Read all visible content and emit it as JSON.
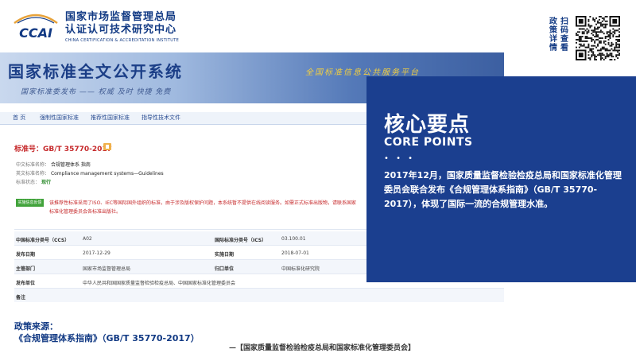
{
  "header": {
    "logo_text": "CCAI",
    "org_name_line1": "国家市场监督管理总局",
    "org_name_line2": "认证认可技术研究中心",
    "org_name_en": "CHINA CERTIFICATION & ACCREDITATION INSTITUTE",
    "scan_text_col1": "政策详情",
    "scan_text_col2": "扫码查看",
    "qr_icon": "qr-code-icon"
  },
  "site": {
    "title": "国家标准全文公开系统",
    "tagline": "国家标准委发布 —— 权威 及时 快捷 免费",
    "slogan": "全国标准信息公共服务平台",
    "nav": [
      "首 页",
      "强制性国家标准",
      "推荐性国家标准",
      "指导性技术文件"
    ],
    "std_number": "标准号：GB/T 35770-2017",
    "cn_name_label": "中文标准名称：",
    "cn_name_value": "合规管理体系 指南",
    "en_name_label": "英文标准名称：",
    "en_name_value": "Compliance management systems—Guidelines",
    "status_label": "标准状态：",
    "status_value": "现行",
    "button_label": "实施信息反馈",
    "notice": "该推荐性标准采用了ISO、IEC等国际国外组织的标准，由于涉及版权保护问题，本系统暂不提供在线阅读服务。如需正式标准出版物，请联系国家标准化管理委员会各标准出版社。",
    "table": [
      {
        "k1": "中国标准分类号（CCS）",
        "v1": "A02",
        "k2": "国际标准分类号（ICS）",
        "v2": "03.100.01"
      },
      {
        "k1": "发布日期",
        "v1": "2017-12-29",
        "k2": "实施日期",
        "v2": "2018-07-01"
      },
      {
        "k1": "主管部门",
        "v1": "国家市场监督管理总局",
        "k2": "归口单位",
        "v2": "中国标准化研究院"
      },
      {
        "k1": "发布单位",
        "v1": "中华人民共和国国家质量监督检验检疫总局、中国国家标准化管理委员会",
        "k2": "",
        "v2": ""
      },
      {
        "k1": "备注",
        "v1": "",
        "k2": "",
        "v2": ""
      }
    ]
  },
  "panel": {
    "title": "核心要点",
    "subtitle": "CORE POINTS",
    "dots": "• • •",
    "body": "2017年12月，国家质量监督检验检疫总局和国家标准化管理委员会联合发布《合规管理体系指南》（GB/T 35770-2017），体现了国际一流的合规管理水准。"
  },
  "source": {
    "label": "政策来源：",
    "value": "《合规管理体系指南》（GB/T 35770-2017）",
    "issuer": "—【国家质量监督检验检疫总局和国家标准化管理委员会】"
  },
  "colors": {
    "brand_blue": "#123a84",
    "panel_blue": "#1b3f8f",
    "accent_red": "#c6292b",
    "accent_green": "#41a33b"
  }
}
